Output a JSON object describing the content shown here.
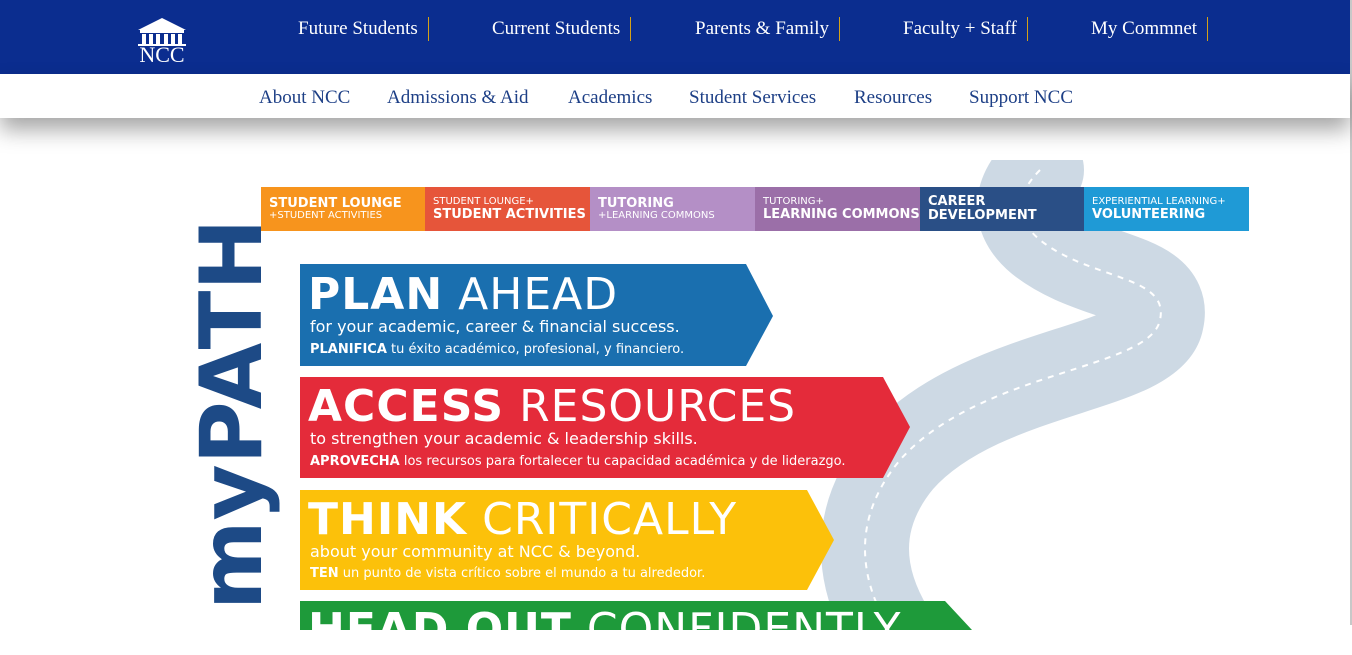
{
  "header": {
    "logo_text": "NCC",
    "top_nav": [
      "Future Students",
      "Current Students",
      "Parents & Family",
      "Faculty + Staff",
      "My Commnet"
    ],
    "sub_nav": [
      "About NCC",
      "Admissions & Aid",
      "Academics",
      "Student Services",
      "Resources",
      "Support NCC"
    ]
  },
  "colors": {
    "top_bar": "#0b2d8f",
    "nav_text": "#1d3f86",
    "nav_divider": "#d4a017",
    "orange": "#f7941d",
    "red_orange": "#e6553a",
    "light_purple": "#b48fc6",
    "purple": "#9b6fa8",
    "navy": "#2a4f86",
    "light_blue": "#1f9ad6",
    "plan_blue": "#1a6faf",
    "access_red": "#e42b3a",
    "think_yellow": "#fcc10a",
    "head_green": "#1e9a3a",
    "road": "#cdd9e4"
  },
  "infographic": {
    "segments": [
      {
        "line1": "STUDENT LOUNGE",
        "line2": "+STUDENT ACTIVITIES"
      },
      {
        "line1": "STUDENT LOUNGE+",
        "line2": "STUDENT ACTIVITIES"
      },
      {
        "line1": "TUTORING",
        "line2": "+LEARNING COMMONS"
      },
      {
        "line1": "TUTORING+",
        "line2": "LEARNING COMMONS"
      },
      {
        "line1": "CAREER",
        "line2": "DEVELOPMENT"
      },
      {
        "line1": "EXPERIENTIAL LEARNING+",
        "line2": "VOLUNTEERING"
      }
    ],
    "title_vertical": "myPATH",
    "banners": [
      {
        "bold": "PLAN",
        "light": " AHEAD",
        "sub": "for your academic, career & financial success.",
        "es_bold": "PLANIFICA",
        "es_rest": " tu éxito académico, profesional, y financiero."
      },
      {
        "bold": "ACCESS",
        "light": " RESOURCES",
        "sub": "to strengthen your academic & leadership skills.",
        "es_bold": "APROVECHA",
        "es_rest": " los recursos para fortalecer tu capacidad académica y de liderazgo."
      },
      {
        "bold": "THINK",
        "light": " CRITICALLY",
        "sub": "about your community at NCC & beyond.",
        "es_bold": "TEN",
        "es_rest": " un punto de vista crítico sobre el mundo a tu alrededor."
      },
      {
        "bold": "HEAD OUT",
        "light": " CONFIDENTLY"
      }
    ]
  }
}
